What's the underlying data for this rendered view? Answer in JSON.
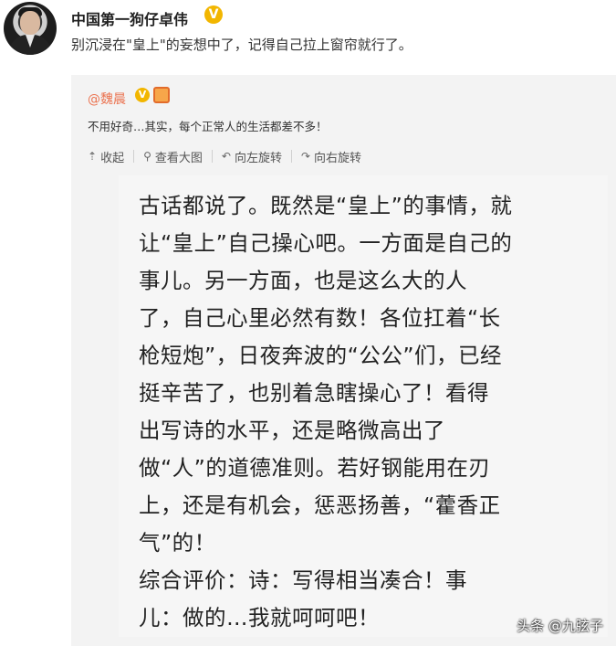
{
  "post": {
    "author": "中国第一狗仔卓伟",
    "verified_badge": "V",
    "text": "别沉浸在\"皇上\"的妄想中了，记得自己拉上窗帘就行了。"
  },
  "repost": {
    "author": "@魏晨",
    "verified_badge": "V",
    "text": "不用好奇…其实，每个正常人的生活都差不多！",
    "toolbar": [
      {
        "icon": "collapse-icon",
        "glyph": "⇡",
        "label": "收起"
      },
      {
        "icon": "search-icon",
        "glyph": "⚲",
        "label": "查看大图"
      },
      {
        "icon": "rotate-left-icon",
        "glyph": "↶",
        "label": "向左旋转"
      },
      {
        "icon": "rotate-right-icon",
        "glyph": "↷",
        "label": "向右旋转"
      }
    ]
  },
  "image_text": {
    "lines": [
      "古话都说了。既然是“皇上”的事情，就",
      "让“皇上”自己操心吧。一方面是自己的",
      "事儿。另一方面，也是这么大的人",
      "了，自己心里必然有数！各位扛着“长",
      "枪短炮”，日夜奔波的“公公”们，已经",
      "挺辛苦了，也别着急瞎操心了！看得",
      "出写诗的水平，还是略微高出了",
      "做“人”的道德准则。若好钢能用在刃",
      "上，还是有机会，惩恶扬善，“藿香正",
      "气”的！",
      "综合评价：诗：写得相当凑合！事",
      "儿：做的…我就呵呵吧！"
    ]
  },
  "watermark": "头条 @九弦子",
  "colors": {
    "link_orange": "#eb7350",
    "badge_gold": "#f2b600",
    "repost_bg": "#f3f3f3"
  }
}
